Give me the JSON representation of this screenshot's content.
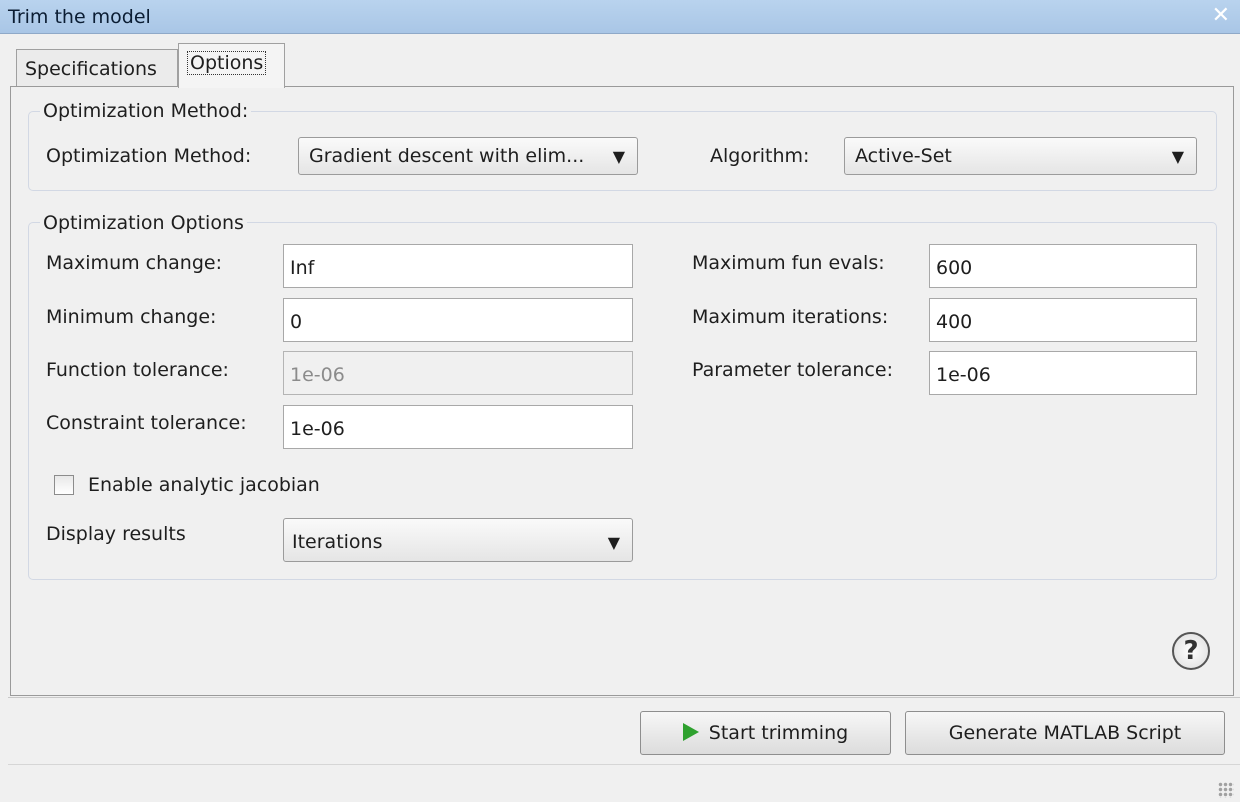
{
  "window": {
    "title": "Trim the model"
  },
  "tabs": [
    {
      "label": "Specifications",
      "active": false
    },
    {
      "label": "Options",
      "active": true
    }
  ],
  "optimization_method_group": {
    "title": "Optimization Method:",
    "method_label": "Optimization Method:",
    "method_value": "Gradient descent with elim...",
    "algorithm_label": "Algorithm:",
    "algorithm_value": "Active-Set"
  },
  "optimization_options_group": {
    "title": "Optimization Options",
    "maximum_change": {
      "label": "Maximum change:",
      "value": "Inf"
    },
    "minimum_change": {
      "label": "Minimum change:",
      "value": "0"
    },
    "function_tolerance": {
      "label": "Function tolerance:",
      "value": "1e-06",
      "enabled": false
    },
    "constraint_tolerance": {
      "label": "Constraint tolerance:",
      "value": "1e-06"
    },
    "maximum_fun_evals": {
      "label": "Maximum fun evals:",
      "value": "600"
    },
    "maximum_iterations": {
      "label": "Maximum iterations:",
      "value": "400"
    },
    "parameter_tolerance": {
      "label": "Parameter tolerance:",
      "value": "1e-06"
    },
    "analytic_jacobian": {
      "label": "Enable analytic jacobian",
      "checked": false
    },
    "display_results": {
      "label": "Display results",
      "value": "Iterations"
    }
  },
  "help": {
    "glyph": "?"
  },
  "buttons": {
    "start_trimming": "Start trimming",
    "generate_script": "Generate MATLAB Script"
  },
  "icons": {
    "close": "close-icon",
    "dropdown": "chevron-down-icon",
    "play": "play-icon",
    "help": "help-icon"
  },
  "colors": {
    "titlebar": "#b9d3ee",
    "play_icon": "#2ea12e"
  }
}
